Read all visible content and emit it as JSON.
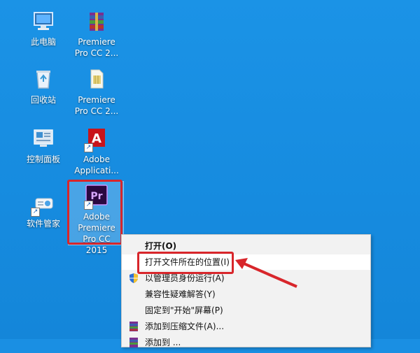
{
  "desktop": {
    "icons": [
      {
        "label": "此电脑"
      },
      {
        "label": "回收站"
      },
      {
        "label": "控制面板"
      },
      {
        "label": "软件管家"
      },
      {
        "label": "Premiere\nPro CC 2..."
      },
      {
        "label": "Premiere\nPro CC 2..."
      },
      {
        "label": "Adobe\nApplicati..."
      },
      {
        "label": "Adobe\nPremiere\nPro CC 2015"
      }
    ],
    "pr_badge": "Pr",
    "adobe_glyph": "A"
  },
  "context_menu": {
    "items": [
      {
        "label": "打开(O)"
      },
      {
        "label": "打开文件所在的位置(I)"
      },
      {
        "label": "以管理员身份运行(A)"
      },
      {
        "label": "兼容性疑难解答(Y)"
      },
      {
        "label": "固定到\"开始\"屏幕(P)"
      },
      {
        "label": "添加到压缩文件(A)..."
      },
      {
        "label": "添加到 ..."
      }
    ]
  },
  "colors": {
    "desktop": "#168bdf",
    "highlight": "#d8262b"
  }
}
